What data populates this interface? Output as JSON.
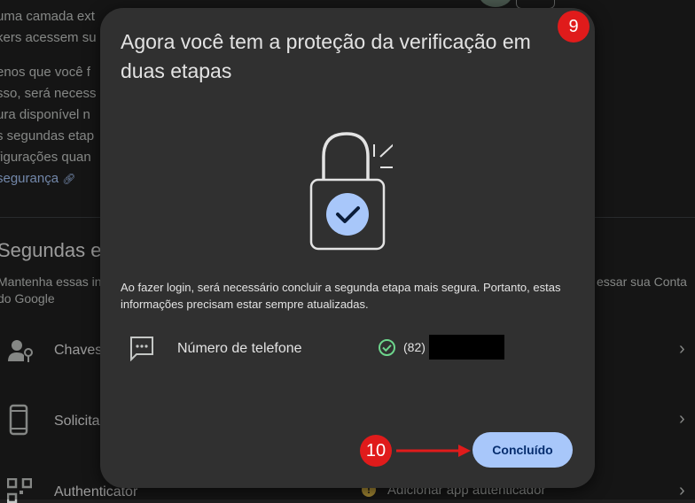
{
  "background": {
    "lines": [
      "uma camada ext",
      "kers acessem su",
      "enos que você f",
      "sso, será necess",
      "ura disponível n",
      "s segundas etap",
      "figurações quan"
    ],
    "security_link": "segurança",
    "section_title": "Segundas e",
    "section_desc_left_1": "Mantenha essas in",
    "section_desc_left_2": "do Google",
    "section_desc_right": "essar sua Conta",
    "rows": [
      {
        "label": "Chaves"
      },
      {
        "label": "Solicita"
      },
      {
        "label": "Authenticator"
      }
    ],
    "warning_text": "Adicionar app autenticador"
  },
  "dialog": {
    "title": "Agora você tem a proteção da verificação em duas etapas",
    "body": "Ao fazer login, será necessário concluir a segunda etapa mais segura. Portanto, estas informações precisam estar sempre atualizadas.",
    "phone_label": "Número de telefone",
    "phone_prefix": "(82)",
    "done_label": "Concluído"
  },
  "annotations": {
    "step_9": "9",
    "step_10": "10"
  },
  "colors": {
    "dialog_bg": "#303030",
    "button_bg": "#a8c7fa",
    "badge_red": "#e01b1b",
    "check_green": "#6dd58c",
    "lock_check_blue": "#a8c7fa"
  }
}
